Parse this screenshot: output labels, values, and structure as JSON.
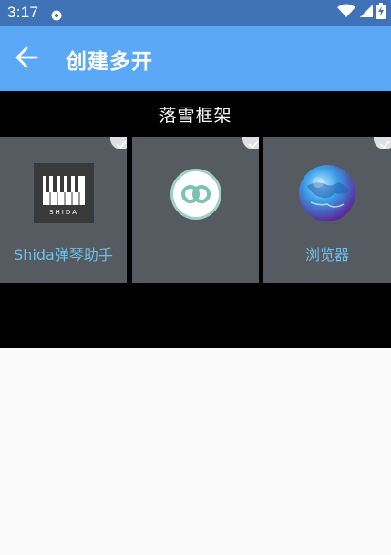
{
  "status_bar": {
    "time": "3:17",
    "notification_icon": "settings-gear-icon",
    "wifi_icon": "wifi-icon",
    "signal_icon": "cell-signal-icon",
    "battery_icon": "battery-charging-icon"
  },
  "app_bar": {
    "back_icon": "arrow-back-icon",
    "title": "创建多开",
    "color": "#5ba8f7"
  },
  "section": {
    "title": "落雪框架"
  },
  "apps": [
    {
      "label": "Shida弹琴助手",
      "icon": "shida-piano-logo-icon",
      "checked": true
    },
    {
      "label": "",
      "icon": "linked-rings-icon",
      "checked": true
    },
    {
      "label": "浏览器",
      "icon": "globe-browser-icon",
      "checked": true
    }
  ],
  "logo_text": "SHIDA",
  "colors": {
    "status_bar": "#3f72b7",
    "app_bar": "#5ba8f7",
    "tile_bg": "#565b61",
    "label": "#6ec0e8"
  }
}
